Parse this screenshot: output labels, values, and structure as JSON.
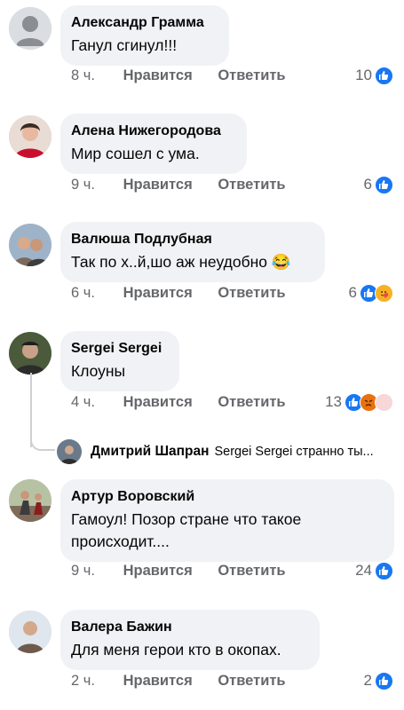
{
  "comments": [
    {
      "author": "Александр Грамма",
      "text": "Ганул сгинул!!!",
      "time": "8 ч.",
      "like": "Нравится",
      "reply": "Ответить",
      "reactions_count": "10",
      "reactions": [
        "like-icon"
      ]
    },
    {
      "author": "Алена Нижегородова",
      "text": "Мир сошел  с ума.",
      "time": "9 ч.",
      "like": "Нравится",
      "reply": "Ответить",
      "reactions_count": "6",
      "reactions": [
        "like-icon"
      ]
    },
    {
      "author": "Валюша Подлубная",
      "text": "Так по х..й,шо аж неудобно",
      "emoji": "😂",
      "time": "6 ч.",
      "like": "Нравится",
      "reply": "Ответить",
      "reactions_count": "6",
      "reactions": [
        "like-icon",
        "care-icon"
      ]
    },
    {
      "author": "Sergei Sergei",
      "text": "Клоуны",
      "time": "4 ч.",
      "like": "Нравится",
      "reply": "Ответить",
      "reactions_count": "13",
      "reactions": [
        "like-icon",
        "angry-icon",
        "extra-reaction-icon"
      ]
    },
    {
      "author": "Артур Воровский",
      "text": "Гамоул! Позор стране что такое происходит....",
      "time": "9 ч.",
      "like": "Нравится",
      "reply": "Ответить",
      "reactions_count": "24",
      "reactions": [
        "like-icon"
      ]
    },
    {
      "author": "Валера Бажин",
      "text": "Для меня герои кто в окопах.",
      "time": "2 ч.",
      "like": "Нравится",
      "reply": "Ответить",
      "reactions_count": "2",
      "reactions": [
        "like-icon"
      ]
    }
  ],
  "reply_preview": {
    "author": "Дмитрий Шапран",
    "text": "Sergei Sergei странно ты..."
  },
  "colors": {
    "like_blue": "#1877f2",
    "bubble": "#f0f2f5",
    "meta_gray": "#65676b"
  }
}
